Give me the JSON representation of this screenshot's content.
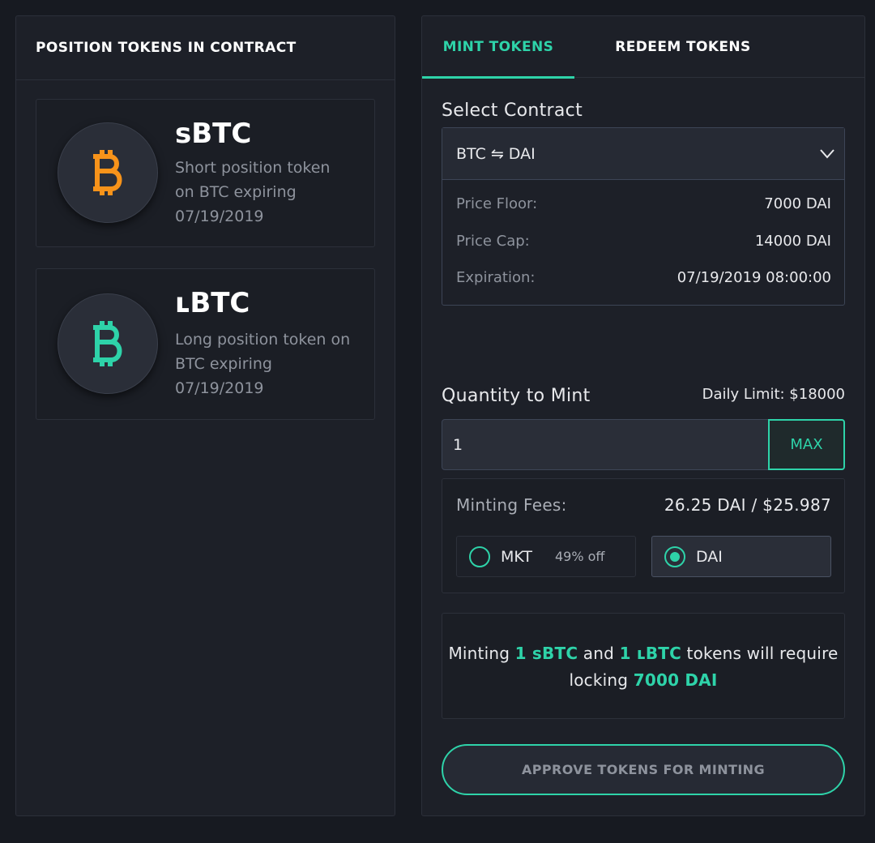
{
  "colors": {
    "accent": "#2ed3a9",
    "short_coin": "#f7931a",
    "long_coin": "#2ed3a9",
    "background": "#171a21",
    "panel": "#1d2028"
  },
  "left_panel": {
    "title": "POSITION TOKENS IN CONTRACT",
    "tokens": [
      {
        "name": "sBTC",
        "description": "Short position token on BTC expiring 07/19/2019",
        "icon": "bitcoin-icon"
      },
      {
        "name": "ʟBTC",
        "description": "Long position token on BTC expiring 07/19/2019",
        "icon": "bitcoin-icon"
      }
    ]
  },
  "tabs": [
    {
      "label": "MINT TOKENS",
      "active": true
    },
    {
      "label": "REDEEM TOKENS",
      "active": false
    }
  ],
  "select_contract": {
    "label": "Select Contract",
    "selected": "BTC ⇋ DAI",
    "icon": "chevron-down-icon",
    "details": [
      {
        "key": "Price Floor:",
        "value": "7000 DAI"
      },
      {
        "key": "Price Cap:",
        "value": "14000 DAI"
      },
      {
        "key": "Expiration:",
        "value": "07/19/2019 08:00:00"
      }
    ]
  },
  "quantity": {
    "label": "Quantity to Mint",
    "daily_limit": "Daily Limit: $18000",
    "value": "1",
    "max_label": "MAX"
  },
  "fees": {
    "label": "Minting Fees:",
    "value": "26.25 DAI / $25.987",
    "options": [
      {
        "label": "MKT",
        "badge": "49% off",
        "selected": false
      },
      {
        "label": "DAI",
        "selected": true
      }
    ]
  },
  "summary": {
    "part1": "Minting ",
    "short_qty": "1 sBTC",
    "part2": " and ",
    "long_qty": "1 ʟBTC",
    "part3": " tokens will require locking ",
    "collateral": "7000 DAI"
  },
  "approve_button": "APPROVE TOKENS FOR MINTING"
}
